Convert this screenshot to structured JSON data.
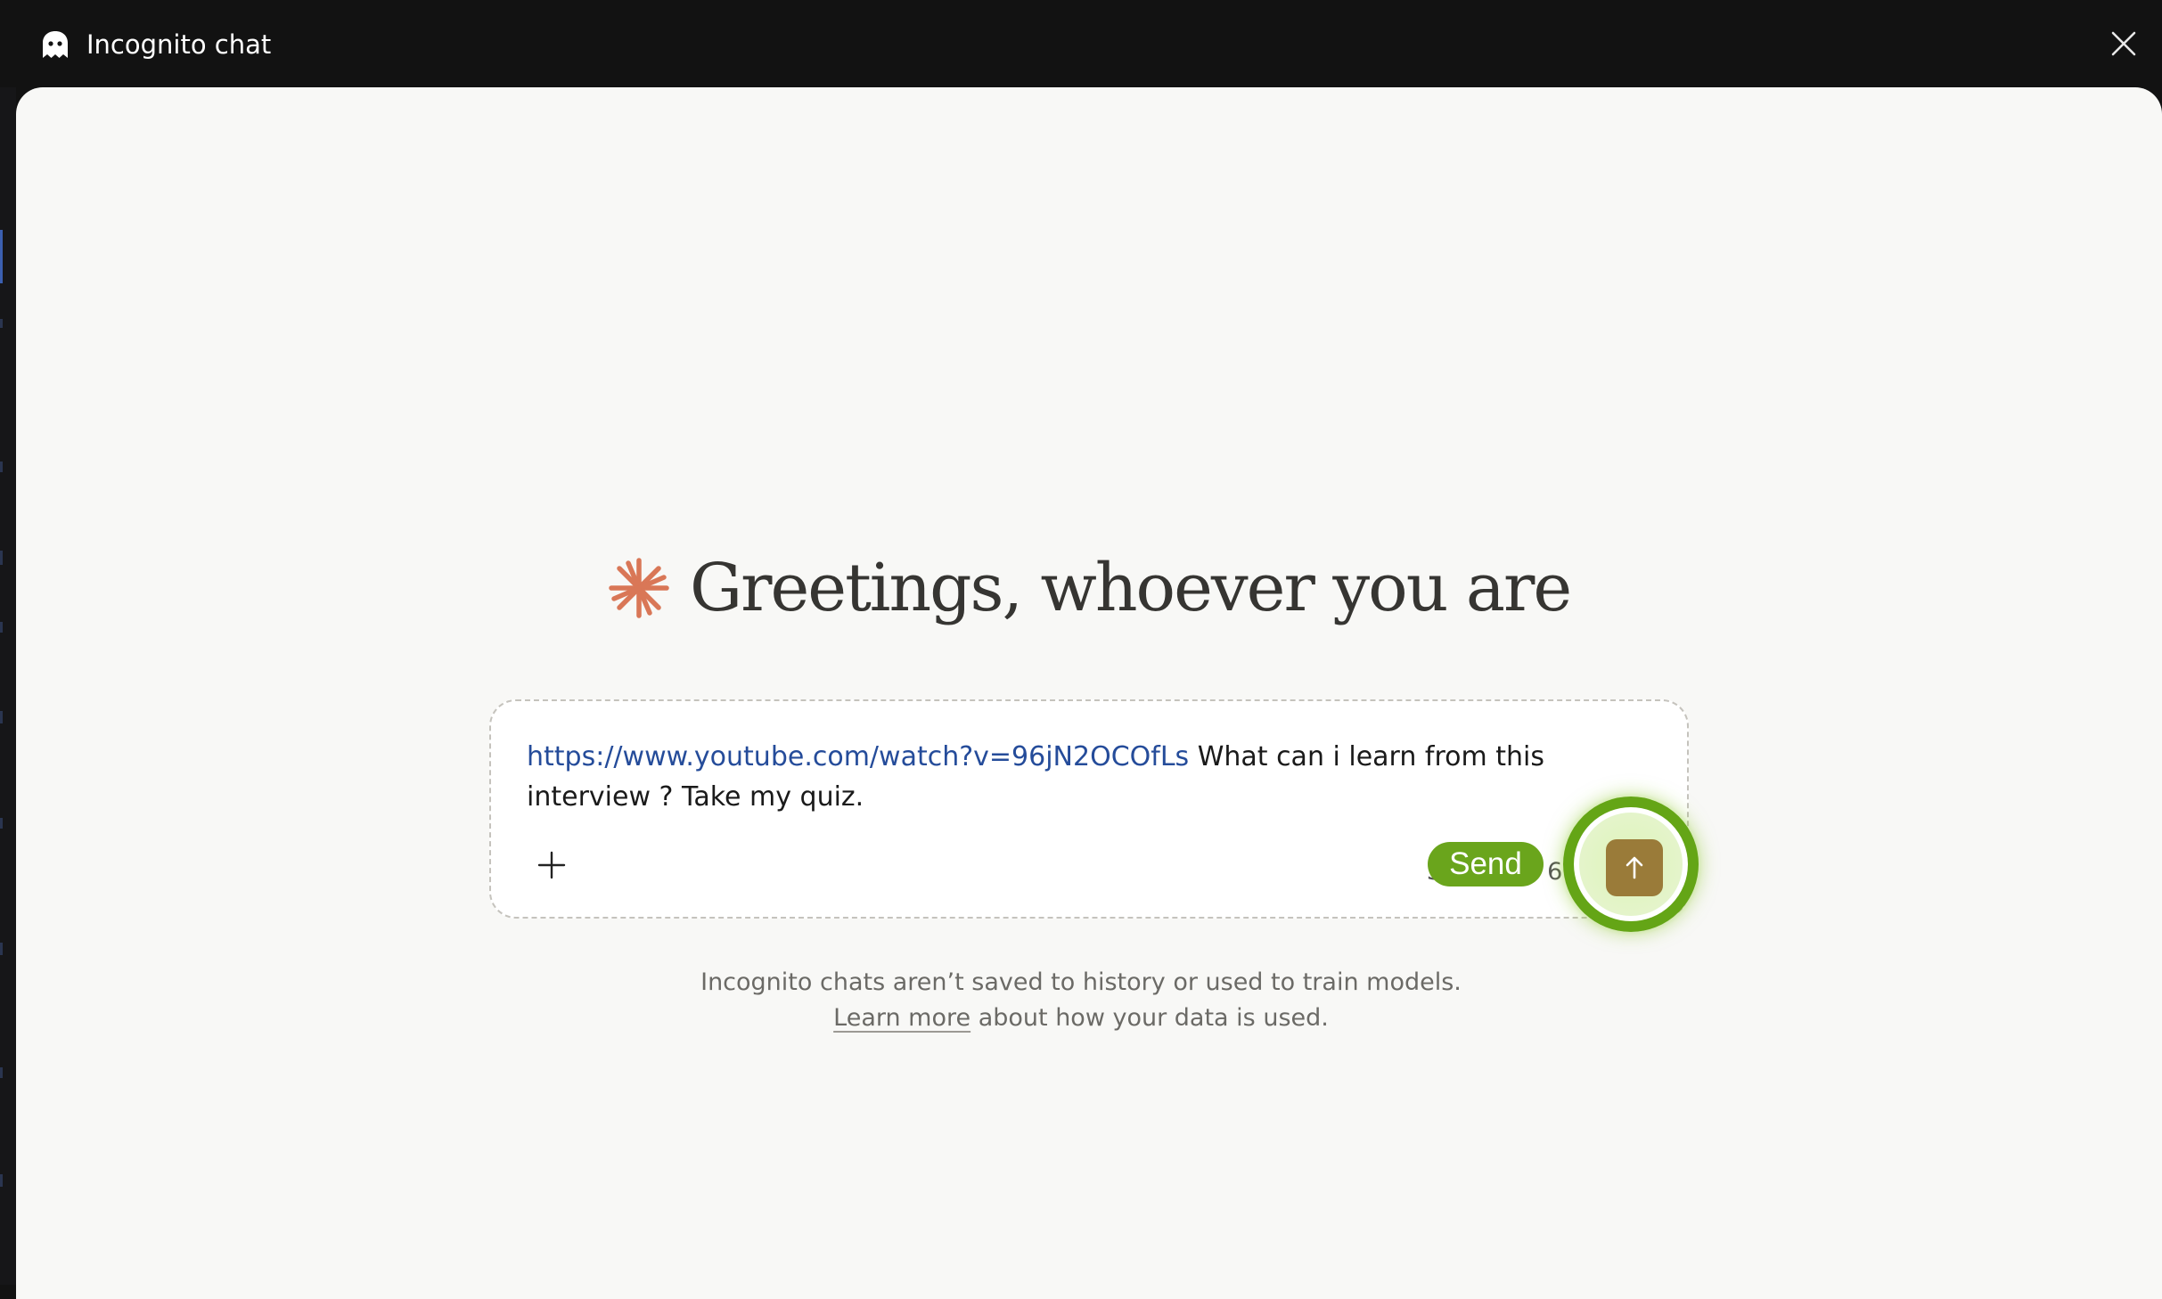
{
  "window": {
    "title": "Incognito chat",
    "title_icon": "ghost-icon",
    "close_icon": "close-icon"
  },
  "main": {
    "greeting_icon": "spark-icon",
    "greeting": "Greetings, whoever you are",
    "composer": {
      "link_text": "https://www.youtube.com/watch?v=96jN2OCOfLs",
      "message_text": " What can i learn from this interview ? Take my quiz.",
      "add_icon": "plus-icon",
      "model_selector_partial": "S",
      "model_selector_partial_end": "6",
      "send_icon": "arrow-up-icon"
    },
    "send_tooltip": "Send",
    "disclaimer": {
      "line1": "Incognito chats aren’t saved to history or used to train models.",
      "learn_more": "Learn more",
      "line2_rest": " about how your data is used."
    }
  },
  "colors": {
    "titlebar": "#121212",
    "panel": "#f8f8f6",
    "spark": "#d97757",
    "link": "#254c9a",
    "send_button": "#9a7b39",
    "highlight_ring": "#64a516"
  }
}
